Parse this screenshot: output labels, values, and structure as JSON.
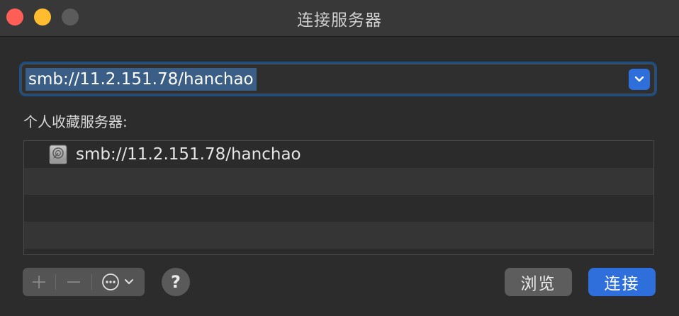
{
  "window": {
    "title": "连接服务器"
  },
  "address": {
    "value": "smb://11.2.151.78/hanchao"
  },
  "favorites": {
    "label": "个人收藏服务器:",
    "items": [
      {
        "label": "smb://11.2.151.78/hanchao",
        "icon": "network-drive-icon"
      }
    ]
  },
  "toolbar": {
    "add_label": "+",
    "remove_label": "−",
    "help_label": "?",
    "browse_label": "浏览",
    "connect_label": "连接"
  },
  "colors": {
    "accent": "#2f6fdc",
    "close": "#ff5f57",
    "minimize": "#febc2e"
  }
}
